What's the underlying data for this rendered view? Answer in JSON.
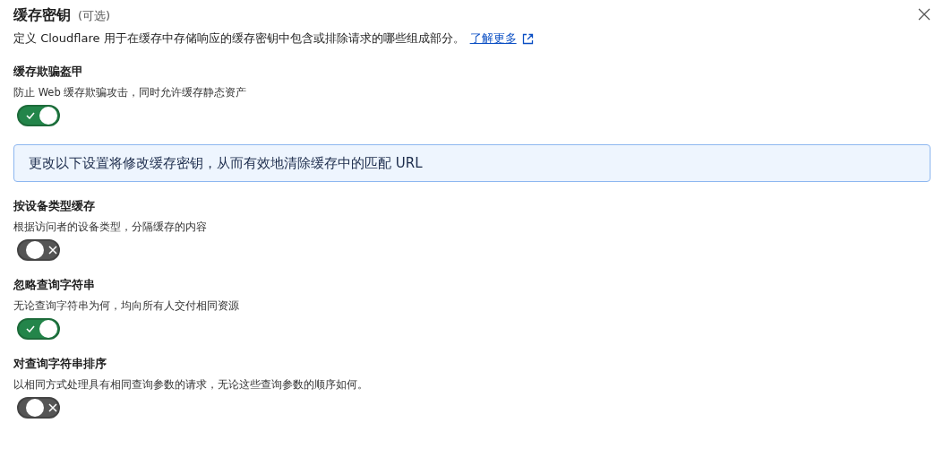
{
  "header": {
    "title": "缓存密钥",
    "optional": "(可选)",
    "description": "定义 Cloudflare 用于在缓存中存储响应的缓存密钥中包含或排除请求的哪些组成部分。",
    "link": "了解更多"
  },
  "items": [
    {
      "kind": "toggle",
      "title": "缓存欺骗盔甲",
      "description": "防止 Web 缓存欺骗攻击，同时允许缓存静态资产",
      "on": true
    },
    {
      "kind": "notice",
      "text": "更改以下设置将修改缓存密钥，从而有效地清除缓存中的匹配 URL"
    },
    {
      "kind": "toggle",
      "title": "按设备类型缓存",
      "description": "根据访问者的设备类型，分隔缓存的内容",
      "on": false
    },
    {
      "kind": "toggle",
      "title": "忽略查询字符串",
      "description": "无论查询字符串为何，均向所有人交付相同资源",
      "on": true
    },
    {
      "kind": "toggle",
      "title": "对查询字符串排序",
      "description": "以相同方式处理具有相同查询参数的请求，无论这些查询参数的顺序如何。",
      "on": false
    }
  ]
}
